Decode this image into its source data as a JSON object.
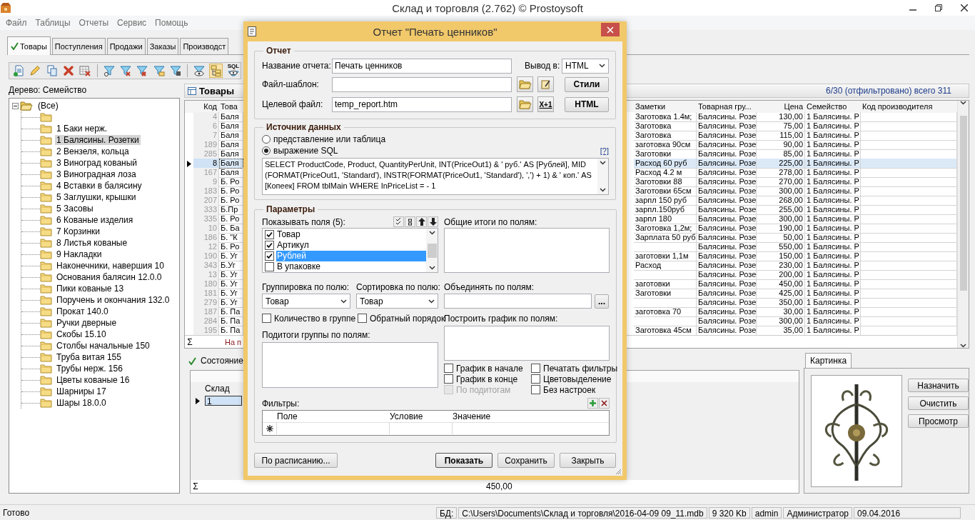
{
  "window": {
    "title": "Склад и торговля (2.762) © Prostoysoft"
  },
  "menu": [
    "Файл",
    "Таблицы",
    "Отчеты",
    "Сервис",
    "Помощь"
  ],
  "tabs": [
    {
      "label": "Товары",
      "selected": true
    },
    {
      "label": "Поступления",
      "selected": false
    },
    {
      "label": "Продажи",
      "selected": false
    },
    {
      "label": "Заказы",
      "selected": false
    },
    {
      "label": "Производст",
      "selected": false
    }
  ],
  "toolbar": {
    "tree_view_pressed": true,
    "sql_label": "SQL"
  },
  "tree": {
    "label": "Дерево: Семейство",
    "root": {
      "label": "(Все)",
      "expanded": true,
      "children": [
        {
          "selected": false
        },
        {
          "label": "1 Баки нерж.",
          "selected": false
        },
        {
          "label": "1 Балясины. Розетки",
          "selected": true
        },
        {
          "label": "2 Вензеля, кольца",
          "selected": false
        },
        {
          "label": "3 Виноград кованый",
          "selected": false
        },
        {
          "label": "3 Виноградная лоза",
          "selected": false
        },
        {
          "label": "4 Вставки в балясину",
          "selected": false
        },
        {
          "label": "5 Заглушки, крышки",
          "selected": false
        },
        {
          "label": "5 Засовы",
          "selected": false
        },
        {
          "label": "6 Кованые изделия",
          "selected": false
        },
        {
          "label": "7 Корзинки",
          "selected": false
        },
        {
          "label": "8 Листья кованые",
          "selected": false
        },
        {
          "label": "9 Накладки",
          "selected": false
        },
        {
          "label": "Наконечники, навершия  10",
          "selected": false
        },
        {
          "label": "Основания балясин 12.0.0",
          "selected": false
        },
        {
          "label": "Пики кованые 13",
          "selected": false
        },
        {
          "label": "Поручень и окончания 132.0",
          "selected": false
        },
        {
          "label": "Прокат 140.0",
          "selected": false
        },
        {
          "label": "Ручки дверные",
          "selected": false
        },
        {
          "label": "Скобы 15.10",
          "selected": false
        },
        {
          "label": "Столбы начальные 150",
          "selected": false
        },
        {
          "label": "Труба витая 155",
          "selected": false
        },
        {
          "label": "Трубы нерж. 156",
          "selected": false
        },
        {
          "label": "Цветы кованые 16",
          "selected": false
        },
        {
          "label": "Шарниры 17",
          "selected": false
        },
        {
          "label": "Шары 18.0.0",
          "selected": false
        }
      ]
    }
  },
  "products": {
    "title": "Товары",
    "summary": "6/30 (отфильтровано) всего 311",
    "columns_left": [
      "Код",
      "Това"
    ],
    "columns_right": [
      "Заметки",
      "Товарная гру...",
      "Цена",
      "Семейство",
      "Код производителя"
    ],
    "rows": [
      {
        "code": "4",
        "product": "Баля",
        "notes": "Заготовка 1.4м;",
        "group": "Балясины. Розе",
        "price": "130,00",
        "family": "1 Балясины. Р",
        "selected": false
      },
      {
        "code": "6",
        "product": "Баля",
        "notes": "Заготовка",
        "group": "Балясины. Розе",
        "price": "75,00",
        "family": "1 Балясины. Р",
        "selected": false
      },
      {
        "code": "7",
        "product": "Баля",
        "notes": "Заготовка",
        "group": "Балясины. Розе",
        "price": "115,00",
        "family": "1 Балясины. Р",
        "selected": false
      },
      {
        "code": "189",
        "product": "Баля",
        "notes": "заготовка 90см",
        "group": "Балясины. Розе",
        "price": "90,00",
        "family": "1 Балясины. Р",
        "selected": false
      },
      {
        "code": "285",
        "product": "Баля",
        "notes": "Заготовки",
        "group": "Балясины. Розе",
        "price": "85,00",
        "family": "1 Балясины. Р",
        "selected": false
      },
      {
        "code": "8",
        "product": "Баля",
        "notes": "Расход 60 руб",
        "group": "Балясины. Розе",
        "price": "225,00",
        "family": "1 Балясины. Р",
        "selected": true
      },
      {
        "code": "167",
        "product": "Баля",
        "notes": "Расход 4.2 м",
        "group": "Балясины. Розе",
        "price": "278,00",
        "family": "1 Балясины. Р",
        "selected": false
      },
      {
        "code": "9",
        "product": "Б. Ро",
        "notes": "Заготовки 88",
        "group": "Балясины. Розе",
        "price": "270,00",
        "family": "1 Балясины. Р",
        "selected": false
      },
      {
        "code": "183",
        "product": "Б. Ро",
        "notes": "Заготовки 65см",
        "group": "Балясины. Розе",
        "price": "300,00",
        "family": "1 Балясины. Р",
        "selected": false
      },
      {
        "code": "207",
        "product": "Б. Ро",
        "notes": "зарпл 150 руб",
        "group": "Балясины. Розе",
        "price": "268,00",
        "family": "1 Балясины. Р",
        "selected": false
      },
      {
        "code": "333",
        "product": "Б.Пр",
        "notes": "зарпл.150руб",
        "group": "Балясины. Розе",
        "price": "255,00",
        "family": "1 Балясины. Р",
        "selected": false
      },
      {
        "code": "335",
        "product": "Б. Ро",
        "notes": "зарпл 180",
        "group": "Балясины. Розе",
        "price": "300,00",
        "family": "1 Балясины. Р",
        "selected": false
      },
      {
        "code": "10",
        "product": "Б. Ба",
        "notes": "Заготовка 1,2м;",
        "group": "Балясины. Розе",
        "price": "190,00",
        "family": "1 Балясины. Р",
        "selected": false
      },
      {
        "code": "186",
        "product": "Б. \"К",
        "notes": "Зарплата 50 руб",
        "group": "Балясины. Розе",
        "price": "50,00",
        "family": "1 Балясины. Р",
        "selected": false
      },
      {
        "code": "12",
        "product": "Б. Ро",
        "group": "Балясины. Розе",
        "price": "550,00",
        "family": "1 Балясины. Р",
        "selected": false
      },
      {
        "code": "190",
        "product": "Б. Уг",
        "notes": "заготовки 1,1м",
        "group": "Балясины. Розе",
        "price": "150,00",
        "family": "1 Балясины. Р",
        "selected": false
      },
      {
        "code": "343",
        "product": "Б.Уг",
        "notes": "Расход",
        "group": "Балясины. Розе",
        "price": "230,00",
        "family": "1 Балясины. Р",
        "selected": false
      },
      {
        "code": "13",
        "product": "Б. Уг",
        "group": "Балясины. Розе",
        "price": "200,00",
        "family": "1 Балясины. Р",
        "selected": false
      },
      {
        "code": "180",
        "product": "Б. Уг",
        "notes": "заготовки",
        "group": "Балясины. Розе",
        "price": "450,00",
        "family": "1 Балясины. Р",
        "selected": false
      },
      {
        "code": "181",
        "product": "Б. Уг",
        "notes": "Заготовки",
        "group": "Балясины. Розе",
        "price": "425,00",
        "family": "1 Балясины. Р",
        "selected": false
      },
      {
        "code": "279",
        "product": "Б. Уг",
        "group": "Балясины. Розе",
        "price": "350,00",
        "family": "1 Балясины. Р",
        "selected": false
      },
      {
        "code": "187",
        "product": "Б. Па",
        "notes": "заготовка 70",
        "group": "Балясины. Розе",
        "price": "30,00",
        "family": "1 Балясины. Р",
        "selected": false
      },
      {
        "code": "284",
        "product": "Б. Па",
        "group": "Балясины. Розе",
        "price": "300,00",
        "family": "1 Балясины. Р",
        "selected": false
      },
      {
        "code": "195",
        "product": "Б. Па",
        "notes": "Заготовка 45см",
        "group": "Балясины. Розе",
        "price": "35,00",
        "family": "1 Балясины. Р",
        "selected": false
      }
    ],
    "footer": {
      "marker": "Σ",
      "text": "На п"
    }
  },
  "stock": {
    "tab": {
      "label": "Состояние",
      "selected": true
    },
    "column": "Склад",
    "rows": [
      {
        "value": "1",
        "selected": true
      }
    ],
    "footer": {
      "marker": "Σ",
      "total": "450,00"
    }
  },
  "picture_panel": {
    "tab": {
      "label": "Картинка",
      "selected": true
    },
    "picture": {
      "kind": "picture"
    },
    "buttons": [
      "Назначить",
      "Очистить",
      "Просмотр"
    ]
  },
  "status_bar": {
    "text": "Готово",
    "db_label": "БД:",
    "db_path": "C:\\Users\\Documents\\Склад и торговля\\2016-04-09 09_11.mdb",
    "size": "9 320 Kb",
    "user": "admin",
    "role": "Администратор",
    "date": "09.04.2016"
  },
  "dialog": {
    "title": "Отчет \"Печать ценников\"",
    "report": {
      "legend": "Отчет",
      "name_label": "Название отчета:",
      "name_value": "Печать ценников",
      "output_label": "Вывод в:",
      "output_value": "HTML",
      "template_label": "Файл-шаблон:",
      "target_label": "Целевой файл:",
      "target_value": "temp_report.htm",
      "counter_label": "X+1",
      "styles_button": "Стили",
      "html_button": "HTML"
    },
    "source": {
      "legend": "Источник данных",
      "options": [
        {
          "label": "представление или таблица",
          "selected": false
        },
        {
          "label": "выражение SQL",
          "selected": true
        }
      ],
      "help": "[?]",
      "sql": "SELECT ProductCode, Product, QuantityPerUnit, INT(PriceOut1) & ' руб.' AS [Рублей], MID (FORMAT(PriceOut1, 'Standard'), INSTR(FORMAT(PriceOut1, 'Standard'), ',') + 1) & ' коп.' AS [Копеек] FROM tblMain WHERE InPriceList = - 1"
    },
    "params": {
      "legend": "Параметры",
      "fields_label": "Показывать поля (5):",
      "fields": [
        {
          "label": "Товар",
          "checked": true,
          "selected": false
        },
        {
          "label": "Артикул",
          "checked": true,
          "selected": false
        },
        {
          "label": "Рублей",
          "checked": true,
          "selected": true
        },
        {
          "label": "В упаковке",
          "checked": false,
          "selected": false
        }
      ],
      "totals_label": "Общие итоги по полям:",
      "group_label": "Группировка по полю:",
      "group_value": "Товар",
      "sort_label": "Сортировка по полю:",
      "sort_value": "Товар",
      "merge_label": "Объединять по полям:",
      "merge_button": "...",
      "count_in_group": {
        "label": "Количество в группе",
        "checked": false
      },
      "reverse_order": {
        "label": "Обратный порядок",
        "checked": false
      },
      "chart_label": "Построить график по полям:",
      "subtotals_label": "Подитоги группы по полям:",
      "chart_options": [
        {
          "label": "График в начале",
          "checked": false,
          "disabled": false
        },
        {
          "label": "График в конце",
          "checked": false,
          "disabled": false
        },
        {
          "label": "По подитогам",
          "checked": false,
          "disabled": true
        }
      ],
      "print_options": [
        {
          "label": "Печатать фильтры",
          "checked": false,
          "disabled": false
        },
        {
          "label": "Цветовыделение",
          "checked": false,
          "disabled": false
        },
        {
          "label": "Без настроек",
          "checked": false,
          "disabled": false
        }
      ],
      "filters_label": "Фильтры:",
      "filter_columns": [
        "Поле",
        "Условие",
        "Значение"
      ]
    },
    "buttons": {
      "schedule": "По расписанию...",
      "show": "Показать",
      "save": "Сохранить",
      "close": "Закрыть"
    }
  }
}
